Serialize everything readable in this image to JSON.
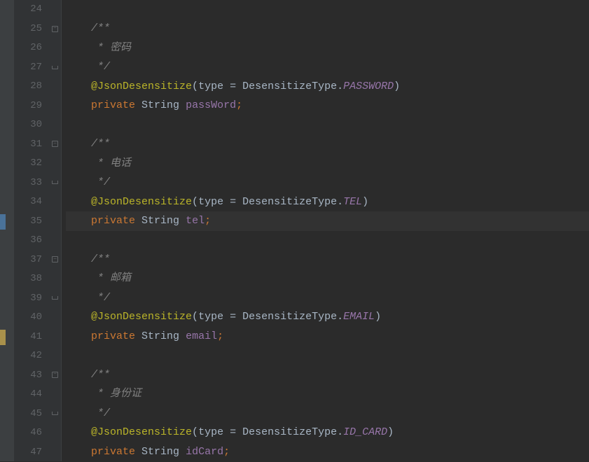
{
  "line_numbers": [
    "24",
    "25",
    "26",
    "27",
    "28",
    "29",
    "30",
    "31",
    "32",
    "33",
    "34",
    "35",
    "36",
    "37",
    "38",
    "39",
    "40",
    "41",
    "42",
    "43",
    "44",
    "45",
    "46",
    "47"
  ],
  "highlighted_line_index": 11,
  "left_markers": [
    {
      "index": 11,
      "color": "blue"
    },
    {
      "index": 17,
      "color": "yellow"
    }
  ],
  "fold_markers": {
    "open": [
      1,
      7,
      13,
      19
    ],
    "close": [
      3,
      9,
      15,
      21
    ]
  },
  "code": {
    "indent": "    ",
    "comment_open": "/**",
    "comment_close": " */",
    "comment_prefix": " * ",
    "password_comment": "密码",
    "tel_comment": "电话",
    "email_comment": "邮箱",
    "idcard_comment": "身份证",
    "annotation": "@JsonDesensitize",
    "type_param": "type",
    "equals": " = ",
    "enum_class": "DesensitizeType",
    "dot": ".",
    "password_enum": "PASSWORD",
    "tel_enum": "TEL",
    "email_enum": "EMAIL",
    "idcard_enum": "ID_CARD",
    "private_kw": "private",
    "string_type": "String",
    "password_field": "passWord",
    "tel_field": "tel",
    "email_field": "email",
    "idcard_field": "idCard",
    "open_paren": "(",
    "close_paren": ")",
    "semicolon": ";"
  }
}
